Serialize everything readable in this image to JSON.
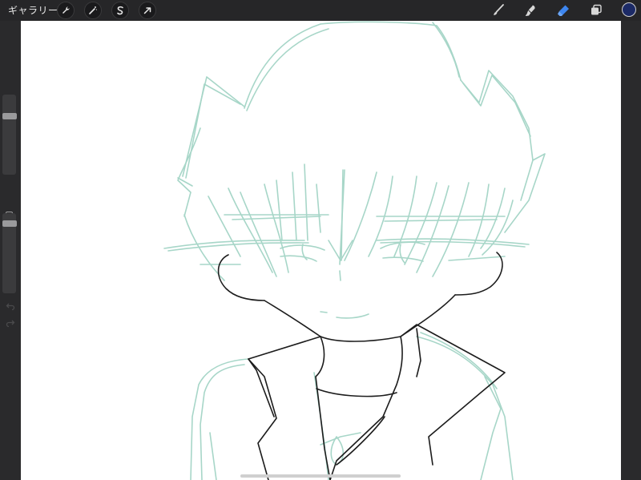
{
  "topbar": {
    "gallery_label": "ギャラリー",
    "left_tools": [
      "wrench-icon",
      "magic-wand-icon",
      "selection-icon",
      "transform-arrow-icon"
    ],
    "right_tools": [
      "brush-icon",
      "smudge-icon",
      "eraser-icon",
      "layers-icon"
    ],
    "active_tool": "eraser-icon",
    "active_color": "#1c2a66",
    "accent_color": "#3d86f0"
  },
  "sidebar": {
    "brush_size_level": 0.75,
    "opacity_level": 0.9
  },
  "canvas": {
    "background": "#ffffff",
    "sketch_color": "#a7d6c8",
    "ink_color": "#1c1c1c"
  }
}
